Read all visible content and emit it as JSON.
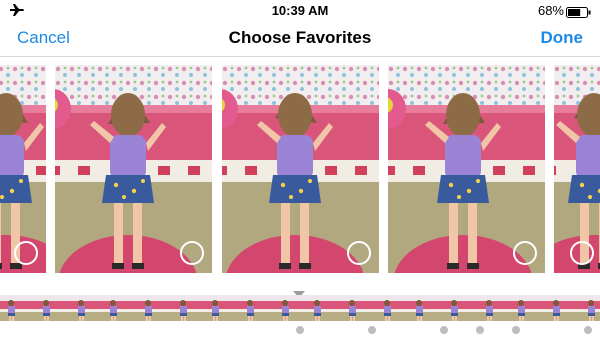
{
  "status_bar": {
    "airplane_icon": "airplane-icon",
    "time": "10:39 AM",
    "battery_percent": "68%",
    "battery_icon": "battery-icon",
    "battery_level": 0.68
  },
  "nav": {
    "cancel_label": "Cancel",
    "title": "Choose Favorites",
    "done_label": "Done"
  },
  "frames": {
    "count": 5,
    "selected": [
      false,
      false,
      false,
      false,
      false
    ]
  },
  "filmstrip": {
    "thumbnail_count": 18,
    "favorite_marker_count": 6
  },
  "colors": {
    "accent": "#1d8ae6",
    "dot": "#bdbdbd"
  }
}
